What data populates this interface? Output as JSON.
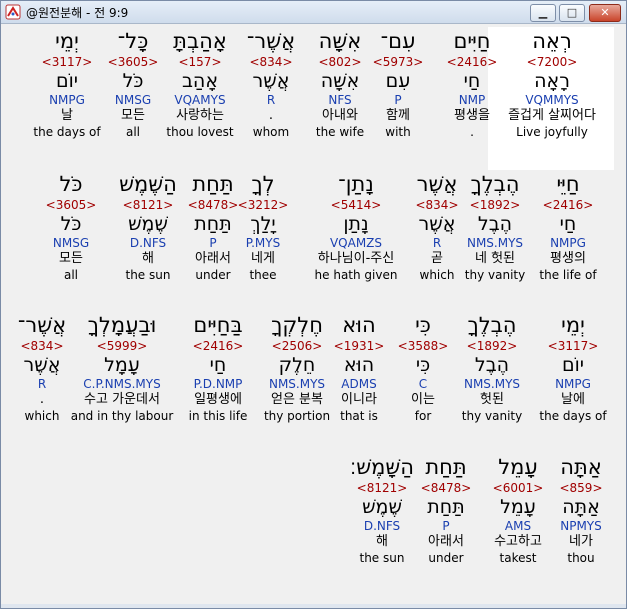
{
  "window": {
    "title": "@원전분해 - 전 9:9",
    "icons": {
      "app": "app-icon",
      "minimize": "minimize-icon",
      "maximize": "maximize-icon",
      "close": "close-icon"
    },
    "buttons": {
      "minimize_glyph": "▁",
      "maximize_glyph": "□",
      "close_glyph": "✕"
    }
  },
  "colors": {
    "strong": "#a00000",
    "morph": "#1a3fb0",
    "highlight_bg": "#ffffff"
  },
  "rows": [
    [
      {
        "heb": "רְאֵה",
        "num": "<7200>",
        "lex": "רָאָה",
        "morph": "VQMMYS",
        "kor": "즐겁게 살찌어다",
        "eng": "Live joyfully",
        "selected": true
      },
      {
        "heb": "חַיִּים",
        "num": "<2416>",
        "lex": "חַי",
        "morph": "NMP",
        "kor": "평생을",
        "eng": "."
      },
      {
        "heb": "עִם־",
        "num": "<5973>",
        "lex": "עִם",
        "morph": "P",
        "kor": "함께",
        "eng": "with"
      },
      {
        "heb": "אִשָּׁה",
        "num": "<802>",
        "lex": "אִשָּׁה",
        "morph": "NFS",
        "kor": "아내와",
        "eng": "the wife"
      },
      {
        "heb": "אֲשֶׁר־",
        "num": "<834>",
        "lex": "אֲשֶׁר",
        "morph": "R",
        "kor": ".",
        "eng": "whom"
      },
      {
        "heb": "אָהַבְתָּ",
        "num": "<157>",
        "lex": "אָהַב",
        "morph": "VQAMYS",
        "kor": "사랑하는",
        "eng": "thou lovest"
      },
      {
        "heb": "כָּל־",
        "num": "<3605>",
        "lex": "כֹּל",
        "morph": "NMSG",
        "kor": "모든",
        "eng": "all"
      },
      {
        "heb": "יְמֵי",
        "num": "<3117>",
        "lex": "יוֹם",
        "morph": "NMPG",
        "kor": "날",
        "eng": "the days of"
      }
    ],
    [
      {
        "heb": "חַיֵּי",
        "num": "<2416>",
        "lex": "חַי",
        "morph": "NMPG",
        "kor": "평생의",
        "eng": "the life of"
      },
      {
        "heb": "הֶבְלֶךָ",
        "num": "<1892>",
        "lex": "הֶבֶל",
        "morph": "NMS.MYS",
        "kor": "네 헛된",
        "eng": "thy vanity"
      },
      {
        "heb": "אֲשֶׁר",
        "num": "<834>",
        "lex": "אֲשֶׁר",
        "morph": "R",
        "kor": "곧",
        "eng": "which"
      },
      {
        "heb": "נָתַן־",
        "num": "<5414>",
        "lex": "נָתַן",
        "morph": "VQAMZS",
        "kor": "하나님이-주신",
        "eng": "he hath given"
      },
      {
        "heb": "לְךָ",
        "num": "<3212>",
        "lex": "יָלַךְ",
        "morph": "P.MYS",
        "kor": "네게",
        "eng": "thee"
      },
      {
        "heb": "תַּחַת",
        "num": "<8478>",
        "lex": "תַּחַת",
        "morph": "P",
        "kor": "아래서",
        "eng": "under"
      },
      {
        "heb": "הַשֶּׁמֶשׁ",
        "num": "<8121>",
        "lex": "שֶׁמֶשׁ",
        "morph": "D.NFS",
        "kor": "해",
        "eng": "the sun"
      },
      {
        "heb": "כֹּל",
        "num": "<3605>",
        "lex": "כֹּל",
        "morph": "NMSG",
        "kor": "모든",
        "eng": "all"
      }
    ],
    [
      {
        "heb": "יְמֵי",
        "num": "<3117>",
        "lex": "יוֹם",
        "morph": "NMPG",
        "kor": "날에",
        "eng": "the days of"
      },
      {
        "heb": "הֶבְלֶךָ",
        "num": "<1892>",
        "lex": "הֶבֶל",
        "morph": "NMS.MYS",
        "kor": "헛된",
        "eng": "thy vanity"
      },
      {
        "heb": "כִּי",
        "num": "<3588>",
        "lex": "כִּי",
        "morph": "C",
        "kor": "이는",
        "eng": "for"
      },
      {
        "heb": "הוּא",
        "num": "<1931>",
        "lex": "הוּא",
        "morph": "ADMS",
        "kor": "이니라",
        "eng": "that is"
      },
      {
        "heb": "חֶלְקְךָ",
        "num": "<2506>",
        "lex": "חֵלֶק",
        "morph": "NMS.MYS",
        "kor": "얻은 분복",
        "eng": "thy portion"
      },
      {
        "heb": "בַּחַיִּים",
        "num": "<2416>",
        "lex": "חַי",
        "morph": "P.D.NMP",
        "kor": "일평생에",
        "eng": "in this life"
      },
      {
        "heb": "וּבַעֲמָלְךָ",
        "num": "<5999>",
        "lex": "עָמָל",
        "morph": "C.P.NMS.MYS",
        "kor": "수고 가운데서",
        "eng": "and in thy labour"
      },
      {
        "heb": "אֲשֶׁר־",
        "num": "<834>",
        "lex": "אֲשֶׁר",
        "morph": "R",
        "kor": ".",
        "eng": "which"
      }
    ],
    [
      {
        "heb": "אַתָּה",
        "num": "<859>",
        "lex": "אַתָּה",
        "morph": "NPMYS",
        "kor": "네가",
        "eng": "thou"
      },
      {
        "heb": "עָמֵל",
        "num": "<6001>",
        "lex": "עָמֵל",
        "morph": "AMS",
        "kor": "수고하고",
        "eng": "takest"
      },
      {
        "heb": "תַּחַת",
        "num": "<8478>",
        "lex": "תַּחַת",
        "morph": "P",
        "kor": "아래서",
        "eng": "under"
      },
      {
        "heb": "הַשָּׁמֶשׁ׃",
        "num": "<8121>",
        "lex": "שֶׁמֶשׁ",
        "morph": "D.NFS",
        "kor": "해",
        "eng": "the sun"
      }
    ]
  ]
}
